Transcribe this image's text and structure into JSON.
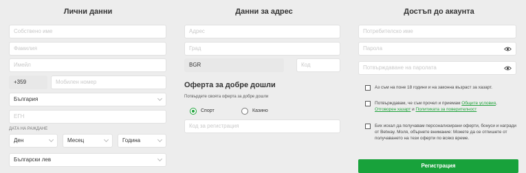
{
  "personal": {
    "title": "Лични данни",
    "first_name_ph": "Собствено име",
    "last_name_ph": "Фамилия",
    "email_ph": "Имейл",
    "phone_code": "+359",
    "phone_ph": "Мобилен номер",
    "country": "България",
    "egn_ph": "ЕГН",
    "dob_label": "ДАТА НА РАЖДАНЕ",
    "day": "Ден",
    "month": "Месец",
    "year": "Година",
    "currency": "Български лев"
  },
  "address": {
    "title": "Данни за адрес",
    "address_ph": "Адрес",
    "city_ph": "Град",
    "country_code": "BGR",
    "zip_ph": "Код",
    "offer_title": "Оферта за добре дошли",
    "offer_hint": "Потвърдете своята оферта за добре дошли",
    "offer_sport": "Спорт",
    "offer_casino": "Казино",
    "promo_ph": "Код за регистрация"
  },
  "account": {
    "title": "Достъп до акаунта",
    "username_ph": "Потребителско име",
    "password_ph": "Парола",
    "password_confirm_ph": "Потвърждаване на паролата",
    "age_text": "Аз съм на поне 18 години и на законна възраст за хазарт.",
    "terms_prefix": "Потвърждавам, че съм прочел и приемам ",
    "terms_link": "Общите условия",
    "terms_comma": ",",
    "responsible_link": "Отговорен хазарт",
    "terms_and": " и ",
    "privacy_link": "Политиката за поверителност",
    "offers_text": "Бих искал да получавам персонализирани оферти, бонуси и награди от Betway. Моля, обърнете внимание: Можете да се отпишете от получаването на тези оферти по всяко време.",
    "register_label": "Регистрация"
  },
  "colors": {
    "accent": "#18a23b",
    "background": "#ededed",
    "input": "#ffffff"
  }
}
